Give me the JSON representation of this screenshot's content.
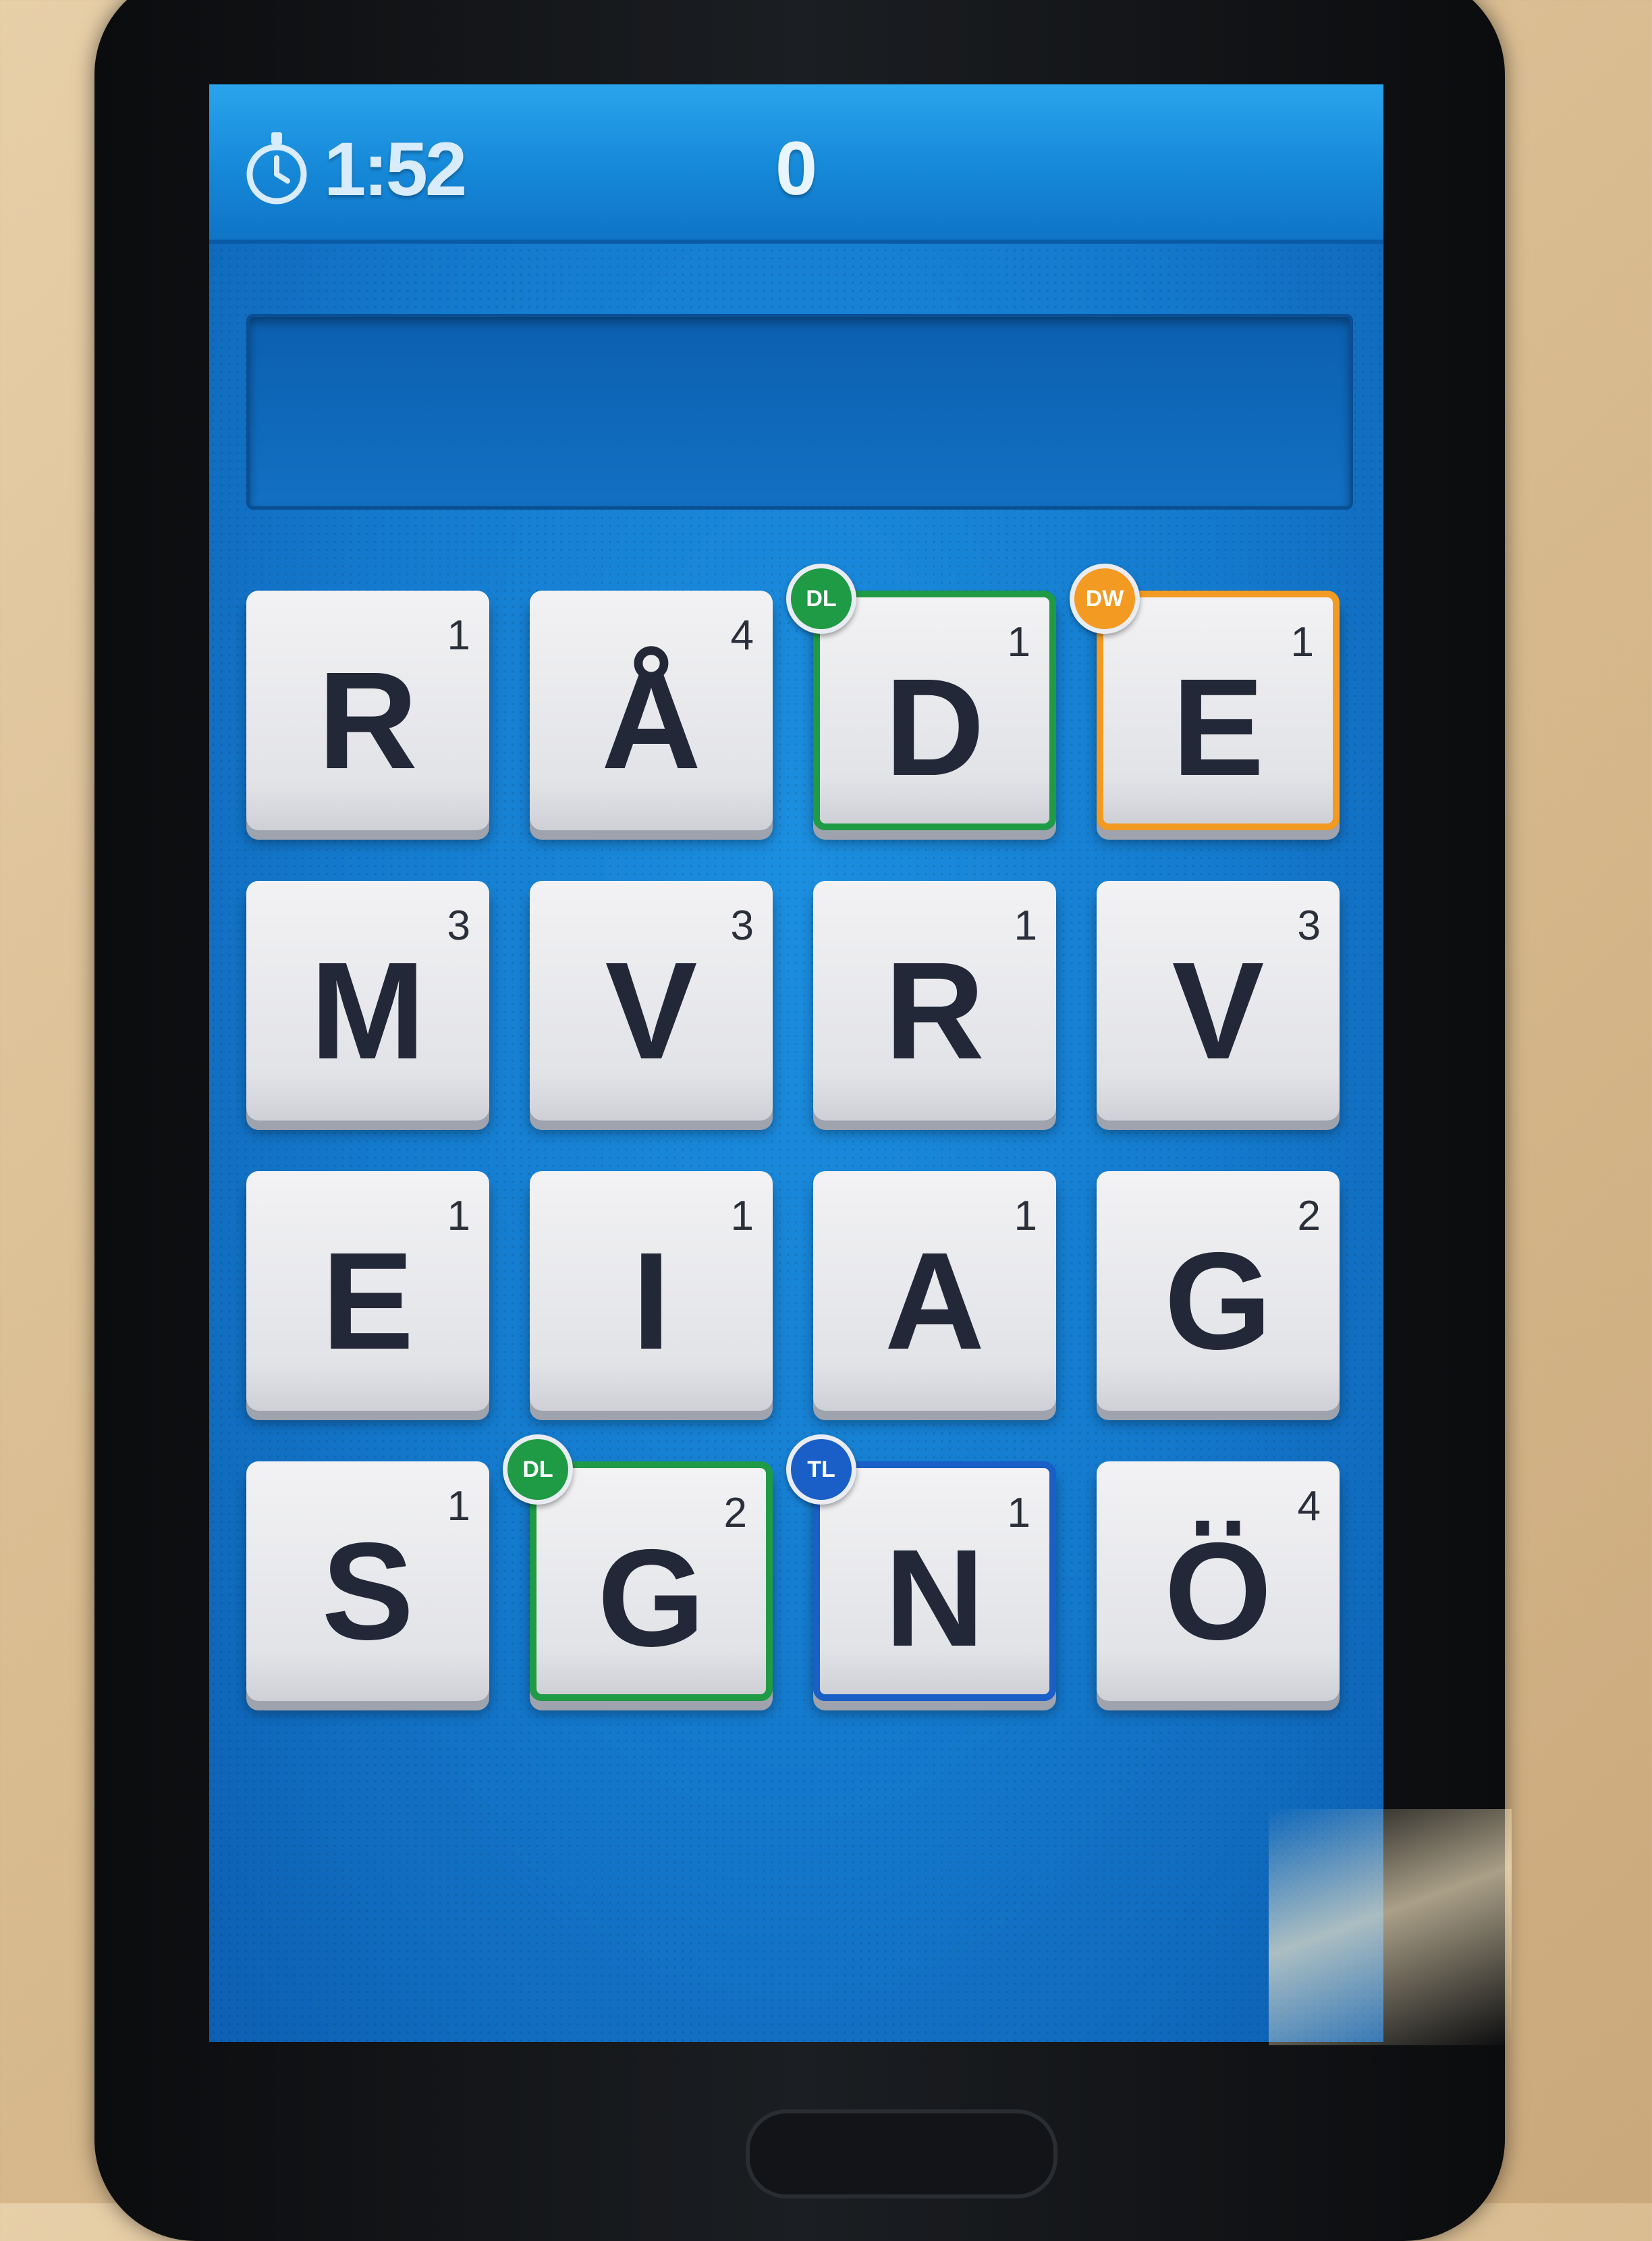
{
  "header": {
    "timer": "1:52",
    "score": "0"
  },
  "word_field": {
    "current_word": ""
  },
  "colors": {
    "dl": "#1f9a45",
    "dw": "#f29a22",
    "tl": "#1a5ec7"
  },
  "board": {
    "tiles": [
      {
        "letter": "R",
        "points": "1",
        "bonus": ""
      },
      {
        "letter": "Å",
        "points": "4",
        "bonus": ""
      },
      {
        "letter": "D",
        "points": "1",
        "bonus": "DL"
      },
      {
        "letter": "E",
        "points": "1",
        "bonus": "DW"
      },
      {
        "letter": "M",
        "points": "3",
        "bonus": ""
      },
      {
        "letter": "V",
        "points": "3",
        "bonus": ""
      },
      {
        "letter": "R",
        "points": "1",
        "bonus": ""
      },
      {
        "letter": "V",
        "points": "3",
        "bonus": ""
      },
      {
        "letter": "E",
        "points": "1",
        "bonus": ""
      },
      {
        "letter": "I",
        "points": "1",
        "bonus": ""
      },
      {
        "letter": "A",
        "points": "1",
        "bonus": ""
      },
      {
        "letter": "G",
        "points": "2",
        "bonus": ""
      },
      {
        "letter": "S",
        "points": "1",
        "bonus": ""
      },
      {
        "letter": "G",
        "points": "2",
        "bonus": "DL"
      },
      {
        "letter": "N",
        "points": "1",
        "bonus": "TL"
      },
      {
        "letter": "Ö",
        "points": "4",
        "bonus": ""
      }
    ]
  }
}
